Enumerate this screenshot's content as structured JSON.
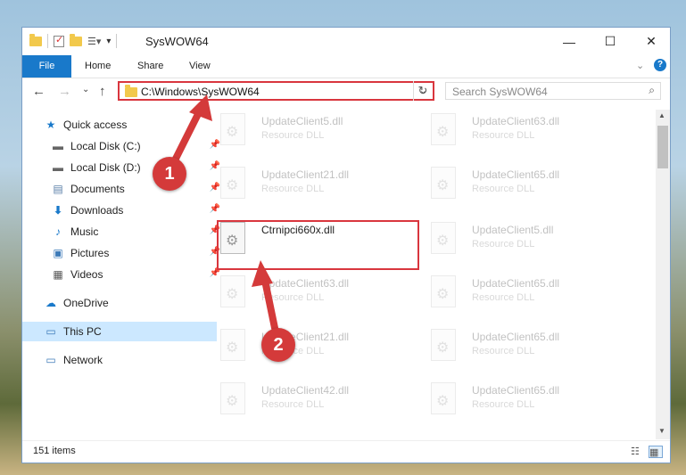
{
  "window": {
    "title": "SysWOW64"
  },
  "ribbon": {
    "tabs": [
      "File",
      "Home",
      "Share",
      "View"
    ]
  },
  "nav": {
    "address": "C:\\Windows\\SysWOW64",
    "search_placeholder": "Search SysWOW64"
  },
  "sidebar": {
    "items": [
      {
        "label": "Quick access",
        "icon": "star-icon",
        "pinned": false
      },
      {
        "label": "Local Disk (C:)",
        "icon": "drive-icon",
        "pinned": true
      },
      {
        "label": "Local Disk (D:)",
        "icon": "drive-icon",
        "pinned": true
      },
      {
        "label": "Documents",
        "icon": "documents-icon",
        "pinned": true
      },
      {
        "label": "Downloads",
        "icon": "download-arrow-icon",
        "pinned": true
      },
      {
        "label": "Music",
        "icon": "music-icon",
        "pinned": true
      },
      {
        "label": "Pictures",
        "icon": "pictures-icon",
        "pinned": true
      },
      {
        "label": "Videos",
        "icon": "videos-icon",
        "pinned": true
      },
      {
        "label": "OneDrive",
        "icon": "cloud-icon",
        "pinned": false
      },
      {
        "label": "This PC",
        "icon": "computer-icon",
        "pinned": false,
        "selected": true
      },
      {
        "label": "Network",
        "icon": "network-icon",
        "pinned": false
      }
    ]
  },
  "files": [
    {
      "name": "UpdateClient5.dll",
      "type": "Resource DLL"
    },
    {
      "name": "UpdateClient63.dll",
      "type": "Resource DLL"
    },
    {
      "name": "UpdateClient21.dll",
      "type": "Resource DLL"
    },
    {
      "name": "UpdateClient65.dll",
      "type": "Resource DLL"
    },
    {
      "name": "Ctrnipci660x.dll",
      "type": ""
    },
    {
      "name": "UpdateClient5.dll",
      "type": "Resource DLL"
    },
    {
      "name": "UpdateClient63.dll",
      "type": "Resource DLL"
    },
    {
      "name": "UpdateClient65.dll",
      "type": "Resource DLL"
    },
    {
      "name": "UpdateClient21.dll",
      "type": "Resource DLL"
    },
    {
      "name": "UpdateClient65.dll",
      "type": "Resource DLL"
    },
    {
      "name": "UpdateClient42.dll",
      "type": "Resource DLL"
    },
    {
      "name": "UpdateClient65.dll",
      "type": "Resource DLL"
    }
  ],
  "status": {
    "count": "151 items"
  },
  "annotations": {
    "badge1": "1",
    "badge2": "2",
    "color": "#d43a3a"
  }
}
